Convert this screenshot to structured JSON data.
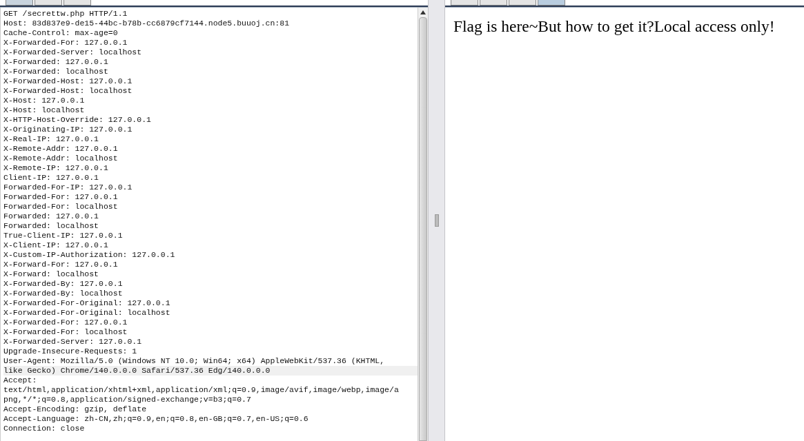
{
  "request_pane": {
    "tabs": [
      {
        "selected": true
      },
      {
        "selected": false
      },
      {
        "selected": false
      }
    ],
    "lines": [
      {
        "text": "GET /secrettw.php HTTP/1.1",
        "current": false
      },
      {
        "text": "Host: 83d837e9-de15-44bc-b78b-cc6879cf7144.node5.buuoj.cn:81",
        "current": false
      },
      {
        "text": "Cache-Control: max-age=0",
        "current": false
      },
      {
        "text": "X-Forwarded-For: 127.0.0.1",
        "current": false
      },
      {
        "text": "X-Forwarded-Server: localhost",
        "current": false
      },
      {
        "text": "X-Forwarded: 127.0.0.1",
        "current": false
      },
      {
        "text": "X-Forwarded: localhost",
        "current": false
      },
      {
        "text": "X-Forwarded-Host: 127.0.0.1",
        "current": false
      },
      {
        "text": "X-Forwarded-Host: localhost",
        "current": false
      },
      {
        "text": "X-Host: 127.0.0.1",
        "current": false
      },
      {
        "text": "X-Host: localhost",
        "current": false
      },
      {
        "text": "X-HTTP-Host-Override: 127.0.0.1",
        "current": false
      },
      {
        "text": "X-Originating-IP: 127.0.0.1",
        "current": false
      },
      {
        "text": "X-Real-IP: 127.0.0.1",
        "current": false
      },
      {
        "text": "X-Remote-Addr: 127.0.0.1",
        "current": false
      },
      {
        "text": "X-Remote-Addr: localhost",
        "current": false
      },
      {
        "text": "X-Remote-IP: 127.0.0.1",
        "current": false
      },
      {
        "text": "Client-IP: 127.0.0.1",
        "current": false
      },
      {
        "text": "Forwarded-For-IP: 127.0.0.1",
        "current": false
      },
      {
        "text": "Forwarded-For: 127.0.0.1",
        "current": false
      },
      {
        "text": "Forwarded-For: localhost",
        "current": false
      },
      {
        "text": "Forwarded: 127.0.0.1",
        "current": false
      },
      {
        "text": "Forwarded: localhost",
        "current": false
      },
      {
        "text": "True-Client-IP: 127.0.0.1",
        "current": false
      },
      {
        "text": "X-Client-IP: 127.0.0.1",
        "current": false
      },
      {
        "text": "X-Custom-IP-Authorization: 127.0.0.1",
        "current": false
      },
      {
        "text": "X-Forward-For: 127.0.0.1",
        "current": false
      },
      {
        "text": "X-Forward: localhost",
        "current": false
      },
      {
        "text": "X-Forwarded-By: 127.0.0.1",
        "current": false
      },
      {
        "text": "X-Forwarded-By: localhost",
        "current": false
      },
      {
        "text": "X-Forwarded-For-Original: 127.0.0.1",
        "current": false
      },
      {
        "text": "X-Forwarded-For-Original: localhost",
        "current": false
      },
      {
        "text": "X-Forwarded-For: 127.0.0.1",
        "current": false
      },
      {
        "text": "X-Forwarded-For: localhost",
        "current": false
      },
      {
        "text": "X-Forwarded-Server: 127.0.0.1",
        "current": false
      },
      {
        "text": "Upgrade-Insecure-Requests: 1",
        "current": false
      },
      {
        "text": "User-Agent: Mozilla/5.0 (Windows NT 10.0; Win64; x64) AppleWebKit/537.36 (KHTML,",
        "current": false
      },
      {
        "text": "like Gecko) Chrome/140.0.0.0 Safari/537.36 Edg/140.0.0.0",
        "current": true
      },
      {
        "text": "Accept:",
        "current": false
      },
      {
        "text": "text/html,application/xhtml+xml,application/xml;q=0.9,image/avif,image/webp,image/a",
        "current": false
      },
      {
        "text": "png,*/*;q=0.8,application/signed-exchange;v=b3;q=0.7",
        "current": false
      },
      {
        "text": "Accept-Encoding: gzip, deflate",
        "current": false
      },
      {
        "text": "Accept-Language: zh-CN,zh;q=0.9,en;q=0.8,en-GB;q=0.7,en-US;q=0.6",
        "current": false
      },
      {
        "text": "Connection: close",
        "current": false
      }
    ]
  },
  "response_pane": {
    "tabs": [
      {
        "selected": false
      },
      {
        "selected": false
      },
      {
        "selected": false
      },
      {
        "selected": true
      }
    ],
    "rendered_text": "Flag is here~But how to get it?Local access only!"
  }
}
